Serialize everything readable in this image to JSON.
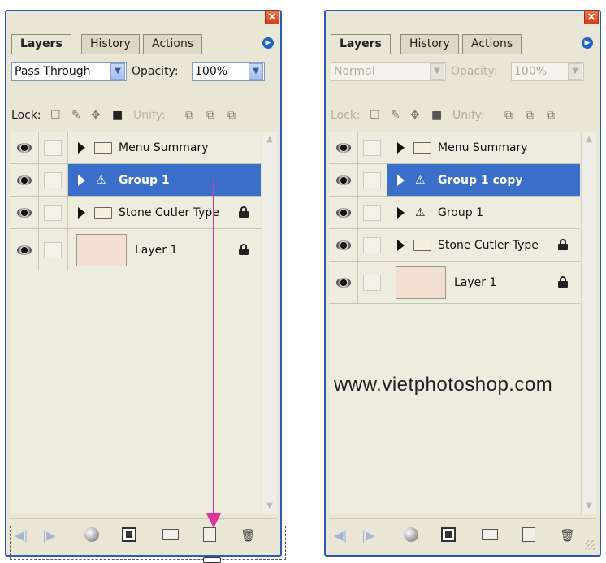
{
  "panels": [
    {
      "tabs": [
        "Layers",
        "History",
        "Actions"
      ],
      "blend_mode": "Pass Through",
      "opacity_label": "Opacity:",
      "opacity_value": "100%",
      "lock_label": "Lock:",
      "unify_label": "Unify:",
      "layers": [
        {
          "name": "Menu Summary",
          "kind": "folder",
          "selected": false,
          "locked": false
        },
        {
          "name": "Group 1",
          "kind": "group",
          "selected": true,
          "locked": false
        },
        {
          "name": "Stone Cutler Type",
          "kind": "folder",
          "selected": false,
          "locked": true
        },
        {
          "name": "Layer 1",
          "kind": "layer",
          "selected": false,
          "locked": true
        }
      ]
    },
    {
      "tabs": [
        "Layers",
        "History",
        "Actions"
      ],
      "blend_mode": "Normal",
      "opacity_label": "Opacity:",
      "opacity_value": "100%",
      "lock_label": "Lock:",
      "unify_label": "Unify:",
      "layers": [
        {
          "name": "Menu Summary",
          "kind": "folder",
          "selected": false,
          "locked": false
        },
        {
          "name": "Group 1 copy",
          "kind": "group",
          "selected": true,
          "locked": false
        },
        {
          "name": "Group 1",
          "kind": "group",
          "selected": false,
          "locked": false
        },
        {
          "name": "Stone Cutler Type",
          "kind": "folder",
          "selected": false,
          "locked": true
        },
        {
          "name": "Layer 1",
          "kind": "layer",
          "selected": false,
          "locked": true
        }
      ]
    }
  ],
  "watermark": "www.vietphotoshop.com",
  "icons": {
    "close": "close-icon",
    "panel_menu": "panel-menu-icon",
    "eye": "eye-icon",
    "folder": "folder-icon",
    "group": "group-icon",
    "lock": "lock-icon",
    "expand": "expand-triangle-icon"
  },
  "colors": {
    "selection": "#3a6ec8",
    "frame": "#2b5db7",
    "panel_bg": "#e9e6d5",
    "drag_arrow": "#e0349a"
  }
}
